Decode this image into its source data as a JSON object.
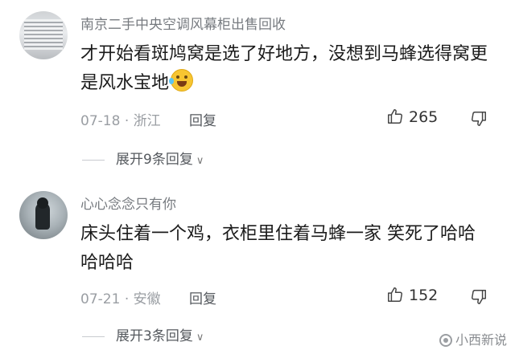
{
  "comments": [
    {
      "username": "南京二手中央空调风幕柜出售回收",
      "text": "才开始看斑鸠窝是选了好地方，没想到马蜂选得窝更是风水宝地",
      "emoji": "laughing-tears-emoji",
      "date": "07-18",
      "location": "浙江",
      "reply_label": "回复",
      "likes": "265",
      "expand_label": "展开9条回复"
    },
    {
      "username": "心心念念只有你",
      "text": "床头住着一个鸡，衣柜里住着马蜂一家 笑死了哈哈哈哈哈",
      "date": "07-21",
      "location": "安徽",
      "reply_label": "回复",
      "likes": "152",
      "expand_label": "展开3条回复"
    }
  ],
  "watermark": "小西新说",
  "colors": {
    "meta": "#9a9ea3",
    "username": "#777b80",
    "text": "#1b1b1b"
  }
}
